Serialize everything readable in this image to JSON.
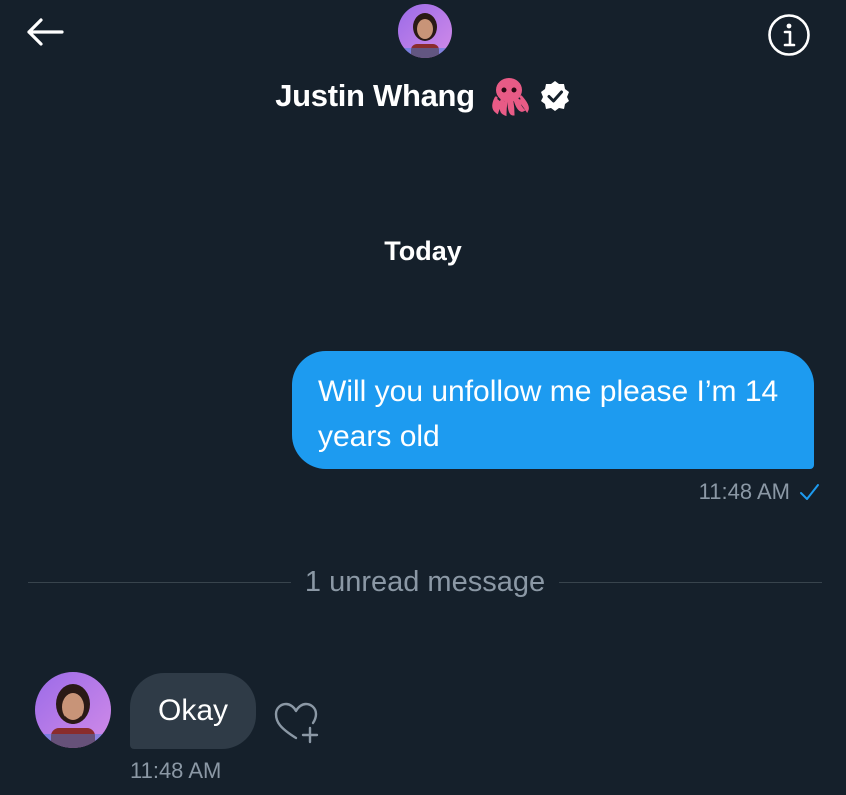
{
  "header": {
    "name": "Justin Whang",
    "name_emoji": "octopus-emoji",
    "verified": true
  },
  "conversation": {
    "date_label": "Today",
    "sent": {
      "text": "Will you unfollow me please I’m 14 years old",
      "time": "11:48 AM",
      "status": "check-icon"
    },
    "unread_label": "1 unread message",
    "received": {
      "text": "Okay",
      "time": "11:48 AM"
    }
  },
  "icons": {
    "back": "back-arrow-icon",
    "info": "info-icon",
    "react": "heart-plus-icon"
  },
  "colors": {
    "background": "#15202b",
    "sent_bubble": "#1d9bf0",
    "received_bubble": "#2f3b47",
    "muted_text": "#8b98a5"
  }
}
